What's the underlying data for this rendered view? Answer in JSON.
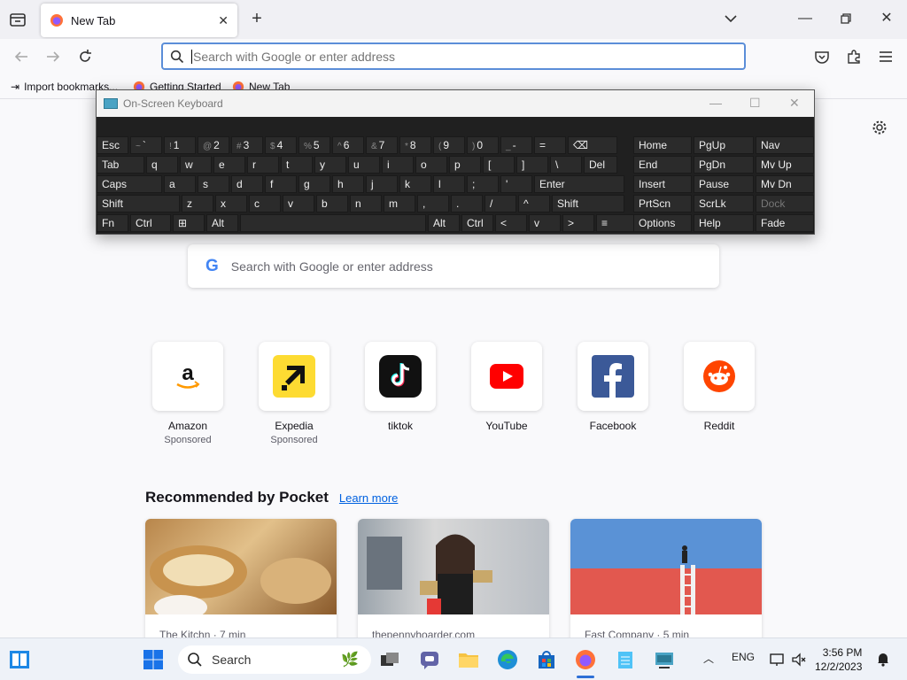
{
  "browser": {
    "tab_title": "New Tab",
    "urlbar_placeholder": "Search with Google or enter address",
    "bookmarks": [
      "Import bookmarks...",
      "Getting Started",
      "New Tab"
    ]
  },
  "osk": {
    "title": "On-Screen Keyboard",
    "rows": [
      [
        "Esc",
        "`",
        "1",
        "2",
        "3",
        "4",
        "5",
        "6",
        "7",
        "8",
        "9",
        "0",
        "-",
        "=",
        "⌫"
      ],
      [
        "Tab",
        "q",
        "w",
        "e",
        "r",
        "t",
        "y",
        "u",
        "i",
        "o",
        "p",
        "[",
        "]",
        "\\",
        "Del"
      ],
      [
        "Caps",
        "a",
        "s",
        "d",
        "f",
        "g",
        "h",
        "j",
        "k",
        "l",
        ";",
        "'",
        "Enter"
      ],
      [
        "Shift",
        "z",
        "x",
        "c",
        "v",
        "b",
        "n",
        "m",
        ",",
        ".",
        "/",
        "^",
        "Shift"
      ],
      [
        "Fn",
        "Ctrl",
        "⊞",
        "Alt",
        "",
        "Alt",
        "Ctrl",
        "<",
        "v",
        ">",
        "≡"
      ]
    ],
    "shift_symbols": [
      "~",
      "!",
      "@",
      "#",
      "$",
      "%",
      "^",
      "&",
      "*",
      "(",
      ")",
      "_",
      "+"
    ],
    "side_keys": [
      [
        "Home",
        "PgUp",
        "Nav"
      ],
      [
        "End",
        "PgDn",
        "Mv Up"
      ],
      [
        "Insert",
        "Pause",
        "Mv Dn"
      ],
      [
        "PrtScn",
        "ScrLk",
        "Dock"
      ],
      [
        "Options",
        "Help",
        "Fade"
      ]
    ]
  },
  "newtab": {
    "search_placeholder": "Search with Google or enter address",
    "shortcuts": [
      {
        "name": "Amazon",
        "sponsored": "Sponsored",
        "icon": "amazon-logo"
      },
      {
        "name": "Expedia",
        "sponsored": "Sponsored",
        "icon": "expedia-logo"
      },
      {
        "name": "tiktok",
        "sponsored": "",
        "icon": "tiktok-logo"
      },
      {
        "name": "YouTube",
        "sponsored": "",
        "icon": "youtube-logo"
      },
      {
        "name": "Facebook",
        "sponsored": "",
        "icon": "facebook-logo"
      },
      {
        "name": "Reddit",
        "sponsored": "",
        "icon": "reddit-logo"
      }
    ],
    "pocket_title": "Recommended by Pocket",
    "pocket_link": "Learn more",
    "cards": [
      {
        "source": "The Kitchn · 7 min"
      },
      {
        "source": "thepennyhoarder.com"
      },
      {
        "source": "Fast Company · 5 min"
      }
    ]
  },
  "taskbar": {
    "search_label": "Search",
    "language": "ENG",
    "time": "3:56 PM",
    "date": "12/2/2023"
  },
  "colors": {
    "accent": "#0061e0",
    "urlbar_focus": "#5b8ed8",
    "osk_bg": "#202020"
  }
}
